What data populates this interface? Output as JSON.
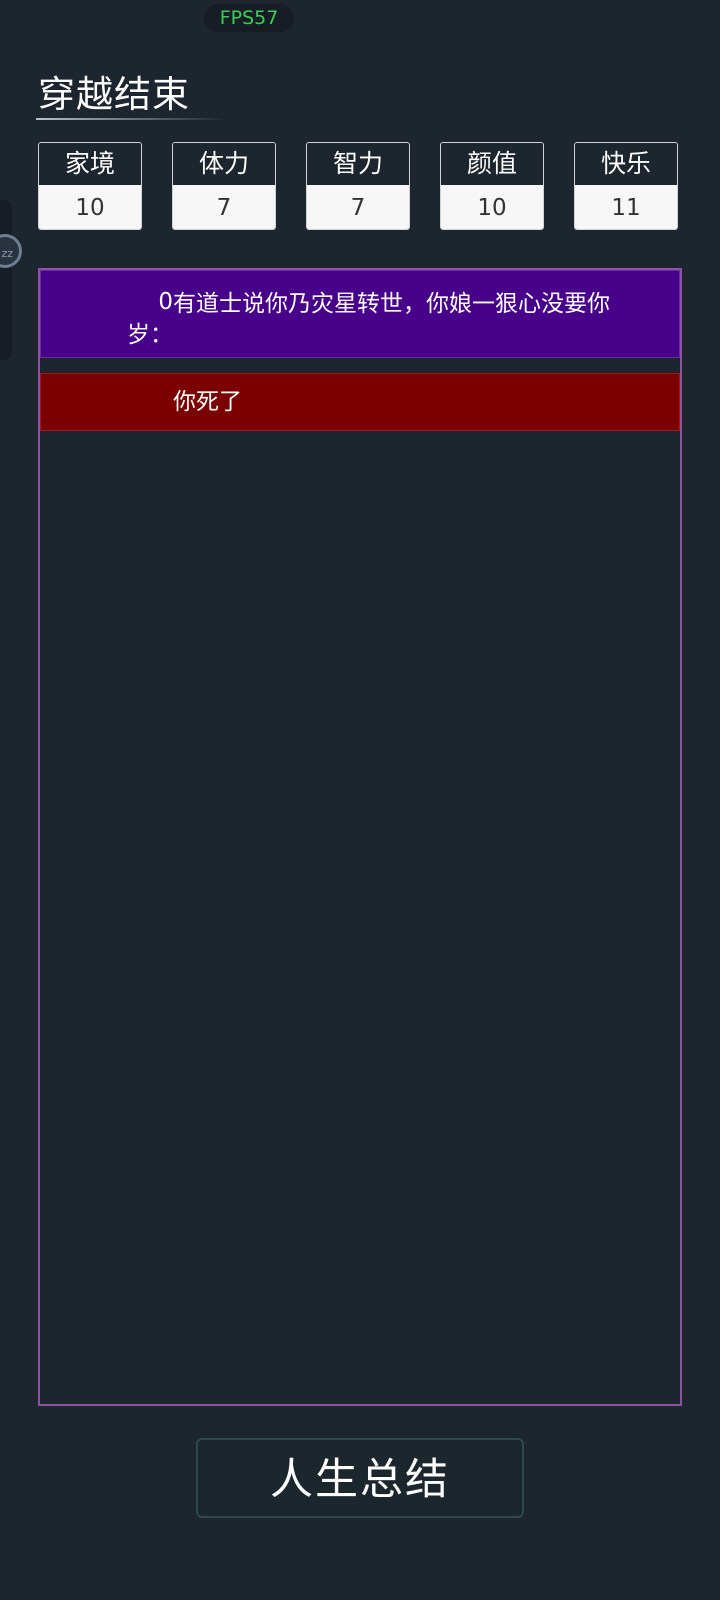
{
  "status": {
    "fps": "FPS57"
  },
  "header": {
    "title": "穿越结束"
  },
  "stats": [
    {
      "label": "家境",
      "value": "10"
    },
    {
      "label": "体力",
      "value": "7"
    },
    {
      "label": "智力",
      "value": "7"
    },
    {
      "label": "颜值",
      "value": "10"
    },
    {
      "label": "快乐",
      "value": "11"
    }
  ],
  "side_widget": {
    "badge": "zz"
  },
  "log": {
    "events": [
      {
        "age": "0岁：",
        "text": "有道士说你乃灾星转世，你娘一狠心没要你",
        "color": "#48008a"
      },
      {
        "age": "",
        "text": "你死了",
        "color": "#7b0000"
      }
    ]
  },
  "actions": {
    "summary_label": "人生总结"
  },
  "colors": {
    "background": "#1d252e",
    "log_border": "#8d54a3",
    "fps_text": "#3ccc58"
  }
}
